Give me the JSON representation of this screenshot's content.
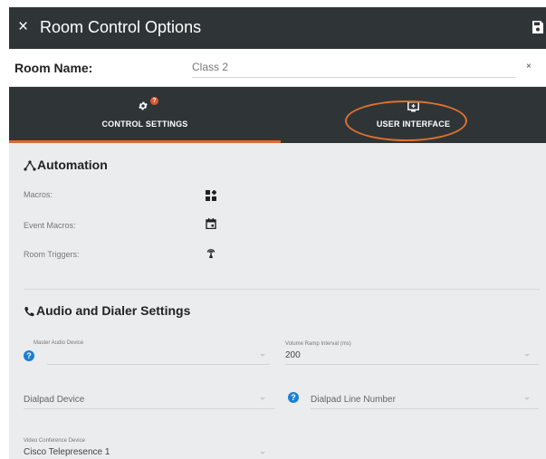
{
  "dialog": {
    "title": "Room Control Options",
    "close_icon": "close-icon",
    "save_icon": "save-icon"
  },
  "room_name": {
    "label": "Room Name:",
    "value": "Class 2",
    "clear_label": "×"
  },
  "tabs": [
    {
      "label": "CONTROL SETTINGS",
      "icon": "gear-icon",
      "badge": "?",
      "active": true
    },
    {
      "label": "USER INTERFACE",
      "icon": "screen-icon",
      "active": false,
      "highlighted": true
    }
  ],
  "automation": {
    "title": "Automation",
    "icon": "hierarchy-icon",
    "rows": [
      {
        "label": "Macros:",
        "icon": "widgets-icon"
      },
      {
        "label": "Event Macros:",
        "icon": "calendar-icon"
      },
      {
        "label": "Room Triggers:",
        "icon": "antenna-icon"
      }
    ]
  },
  "audio": {
    "title": "Audio and Dialer Settings",
    "icon": "phone-icon",
    "master_audio_device": {
      "label": "Master Audio Device",
      "value": ""
    },
    "volume_ramp_interval": {
      "label": "Volume Ramp Interval (ms)",
      "value": "200"
    },
    "dialpad_device": {
      "label": "Dialpad Device"
    },
    "dialpad_line_number": {
      "label": "Dialpad Line Number"
    },
    "video_conference_device": {
      "label": "Video Conference Device",
      "value": "Cisco Telepresence 1"
    }
  },
  "colors": {
    "header_bg": "#2f3537",
    "accent": "#e06a2a",
    "panel_bg": "#ebeced",
    "help_blue": "#1b7fd6"
  }
}
